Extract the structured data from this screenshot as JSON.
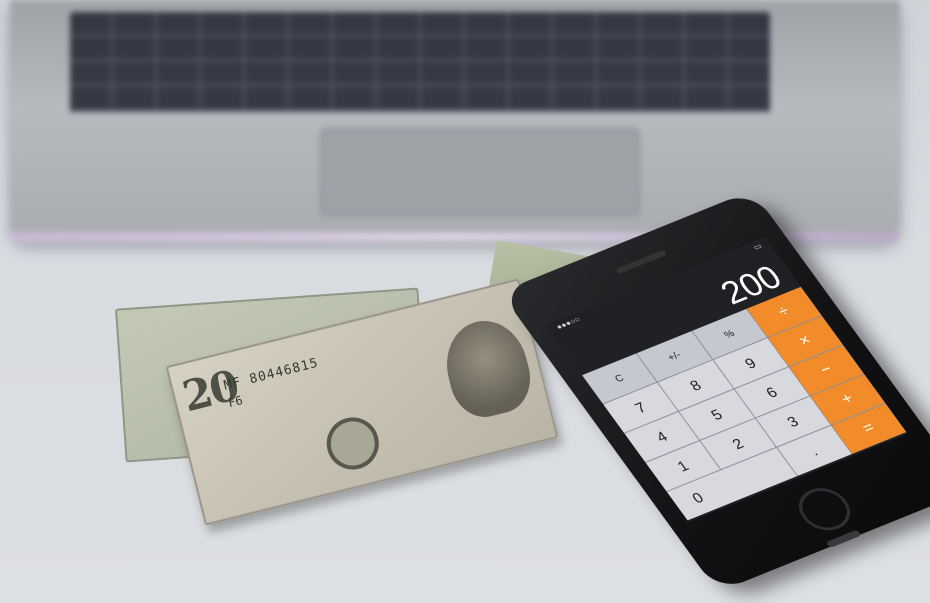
{
  "scene": {
    "subject": "calculator-app"
  },
  "laptop": {},
  "cash": {
    "bill": {
      "denomination": "20",
      "serial": "MF 80446815",
      "code": "F6"
    }
  },
  "phone": {
    "display_value": "200",
    "keys": [
      {
        "label": "C",
        "type": "fn"
      },
      {
        "label": "+/-",
        "type": "fn"
      },
      {
        "label": "%",
        "type": "fn"
      },
      {
        "label": "÷",
        "type": "op"
      },
      {
        "label": "7",
        "type": "num"
      },
      {
        "label": "8",
        "type": "num"
      },
      {
        "label": "9",
        "type": "num"
      },
      {
        "label": "×",
        "type": "op"
      },
      {
        "label": "4",
        "type": "num"
      },
      {
        "label": "5",
        "type": "num"
      },
      {
        "label": "6",
        "type": "num"
      },
      {
        "label": "−",
        "type": "op"
      },
      {
        "label": "1",
        "type": "num"
      },
      {
        "label": "2",
        "type": "num"
      },
      {
        "label": "3",
        "type": "num"
      },
      {
        "label": "+",
        "type": "op"
      },
      {
        "label": "0",
        "type": "zero"
      },
      {
        "label": ".",
        "type": "num"
      },
      {
        "label": "=",
        "type": "op"
      }
    ],
    "colors": {
      "operator": "#f28c2a",
      "key": "#d7d9de"
    }
  }
}
